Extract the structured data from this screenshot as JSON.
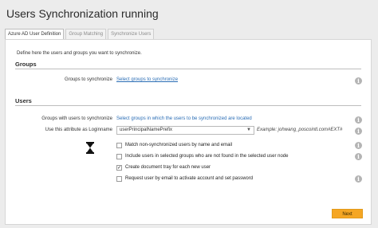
{
  "window": {
    "title": "Users Synchronization running"
  },
  "tabs": [
    "Azure AD User Definition",
    "Group Matching",
    "Synchronize Users"
  ],
  "intro": "Define here the users and groups you want to synchronize.",
  "groups": {
    "heading": "Groups",
    "label": "Groups to synchronize",
    "link": "Select groups to synchronize"
  },
  "users": {
    "heading": "Users",
    "groups_label": "Groups with users to synchronize",
    "groups_value": "Select groups in which the users to be synchronized are located",
    "login_label": "Use this attribute as Loginname",
    "login_value": "userPrincipalNamePrefix",
    "login_example": "Example: johwang_poscointl.com#EXT#",
    "options": [
      {
        "label": "Match non-synchronized users by name and email",
        "checked": false
      },
      {
        "label": "Include users in selected groups who are not found in the selected user node",
        "checked": false
      },
      {
        "label": "Create document tray for each new user",
        "checked": true
      },
      {
        "label": "Request user by email to activate account and set password",
        "checked": false
      }
    ]
  },
  "footer": {
    "next_label": "Next"
  },
  "colors": {
    "accent": "#f5a623",
    "link": "#2a6db5",
    "info_icon": "#b4b4b4"
  },
  "icons": {
    "info": "info-icon",
    "busy": "hourglass-icon",
    "dropdown": "chevron-down-icon",
    "check": "checkmark-icon"
  }
}
